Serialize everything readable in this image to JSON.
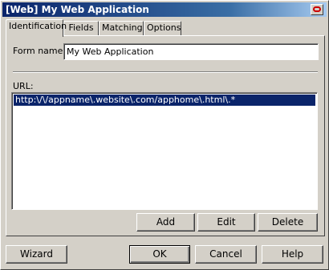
{
  "window": {
    "title": "[Web] My Web Application"
  },
  "tabs": [
    "Identification",
    "Fields",
    "Matching",
    "Options"
  ],
  "form": {
    "name_label": "Form name:",
    "name_value": "My Web Application"
  },
  "url": {
    "label": "URL:",
    "items": [
      "http:\\/\\/appname\\.website\\.com/apphome\\.html\\.*"
    ]
  },
  "list_buttons": {
    "add": "Add",
    "edit": "Edit",
    "delete": "Delete"
  },
  "footer_buttons": {
    "wizard": "Wizard",
    "ok": "OK",
    "cancel": "Cancel",
    "help": "Help"
  },
  "icons": {
    "close": "close-icon"
  }
}
